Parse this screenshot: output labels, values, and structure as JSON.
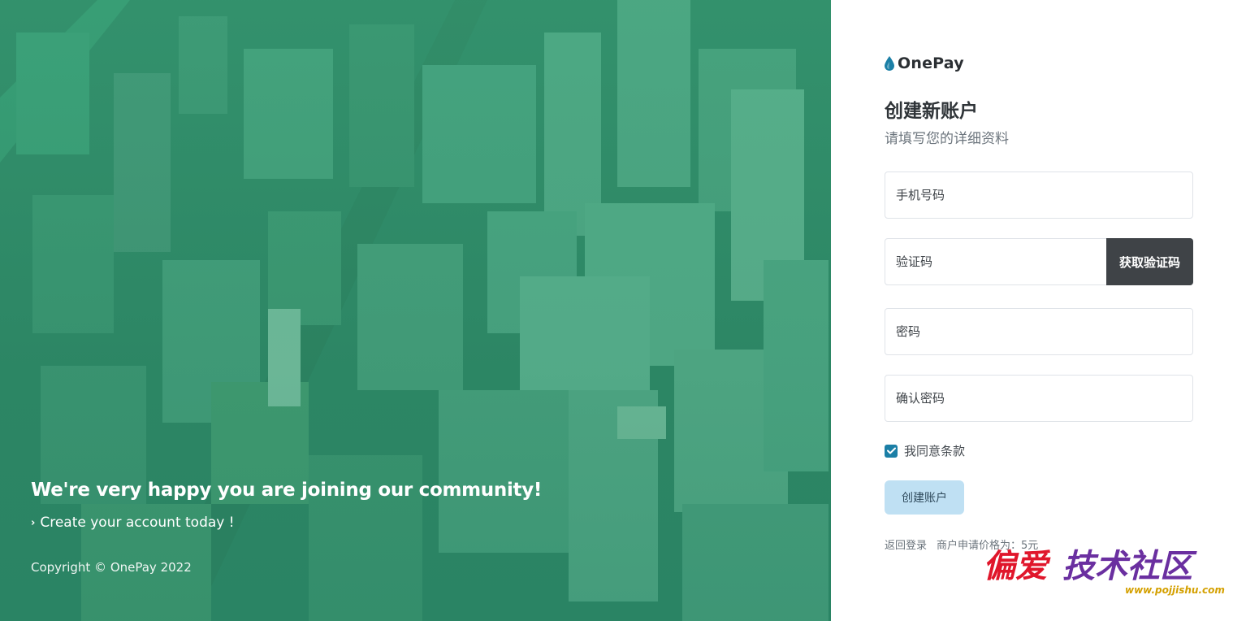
{
  "hero": {
    "heading": "We're very happy you are joining our community!",
    "subheading": "Create your account today !",
    "copyright": "Copyright © OnePay 2022",
    "overlay_color": "#3aa57c"
  },
  "brand": {
    "name": "OnePay",
    "icon": "drop-icon",
    "icon_color": "#1b7fa6"
  },
  "form": {
    "title": "创建新账户",
    "subtitle": "请填写您的详细资料",
    "phone_placeholder": "手机号码",
    "code_placeholder": "验证码",
    "get_code_label": "获取验证码",
    "password_placeholder": "密码",
    "confirm_password_placeholder": "确认密码",
    "agree_label": "我同意条款",
    "agree_checked": true,
    "submit_label": "创建账户"
  },
  "footer": {
    "back_login": "返回登录",
    "price_note": "商户申请价格为：5元"
  },
  "watermark": {
    "text": "偏爱技术社区",
    "url_text": "www.pojjishu.com"
  },
  "colors": {
    "accent": "#1b7fa6",
    "dark_button": "#3f4347",
    "submit_button": "#bfe0f3"
  }
}
